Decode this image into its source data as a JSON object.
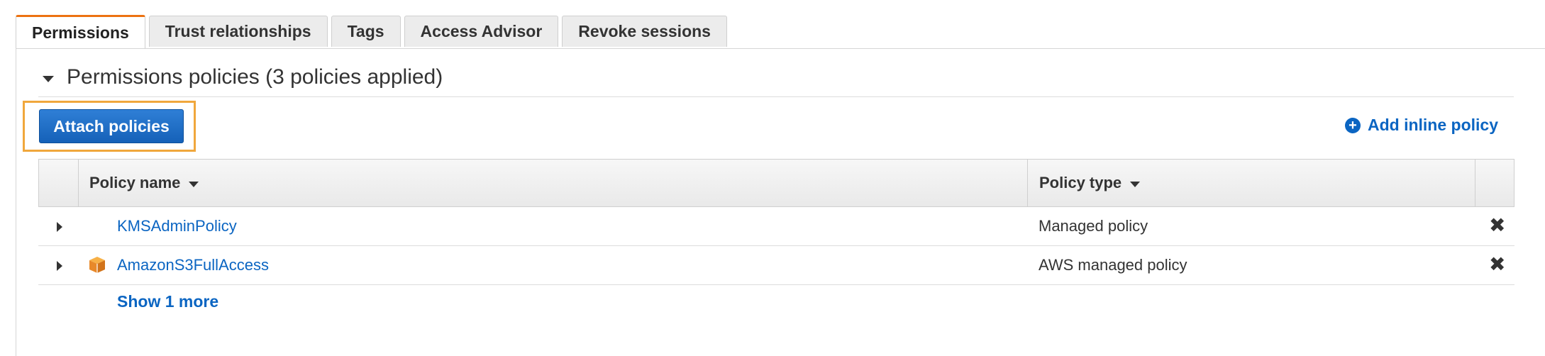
{
  "tabs": [
    {
      "label": "Permissions",
      "active": true
    },
    {
      "label": "Trust relationships",
      "active": false
    },
    {
      "label": "Tags",
      "active": false
    },
    {
      "label": "Access Advisor",
      "active": false
    },
    {
      "label": "Revoke sessions",
      "active": false
    }
  ],
  "section": {
    "title": "Permissions policies (3 policies applied)"
  },
  "actions": {
    "attach_label": "Attach policies",
    "add_inline_label": "Add inline policy",
    "add_inline_icon": "plus-circle-icon"
  },
  "table": {
    "columns": [
      "Policy name",
      "Policy type"
    ],
    "rows": [
      {
        "name": "KMSAdminPolicy",
        "type": "Managed policy",
        "icon": ""
      },
      {
        "name": "AmazonS3FullAccess",
        "type": "AWS managed policy",
        "icon": "aws-managed-box-icon"
      }
    ],
    "show_more": "Show 1 more"
  },
  "colors": {
    "accent": "#ec7211",
    "primary_button": "#1561b8",
    "link": "#0b65c2",
    "highlight": "#f0a73c"
  }
}
